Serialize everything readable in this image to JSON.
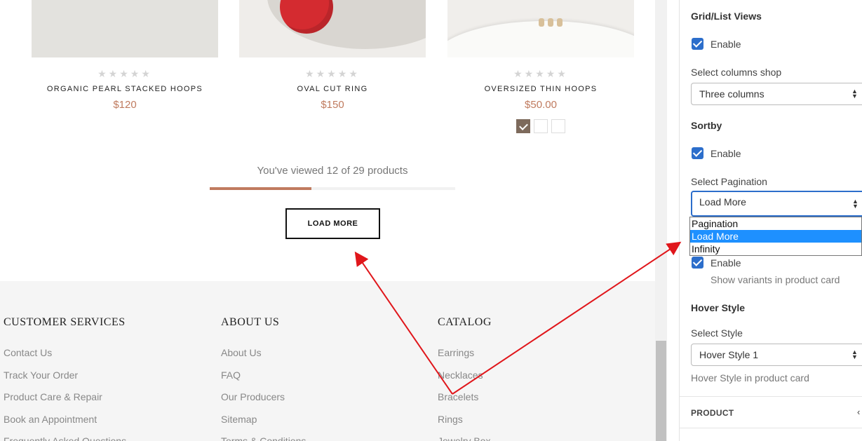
{
  "products": [
    {
      "title": "ORGANIC PEARL STACKED HOOPS",
      "price": "$120",
      "stars": "★★★★★"
    },
    {
      "title": "OVAL CUT RING",
      "price": "$150",
      "stars": "★★★★★"
    },
    {
      "title": "OVERSIZED THIN HOOPS",
      "price": "$50.00",
      "stars": "★★★★★",
      "swatch_count": 3,
      "swatch_selected": 1
    }
  ],
  "pagination": {
    "viewed_text": "You've viewed 12 of 29 products",
    "viewed": 12,
    "total": 29,
    "load_more_label": "LOAD MORE"
  },
  "footer": {
    "columns": [
      {
        "heading": "CUSTOMER SERVICES",
        "links": [
          "Contact Us",
          "Track Your Order",
          "Product Care & Repair",
          "Book an Appointment",
          "Frequently Asked Questions"
        ]
      },
      {
        "heading": "ABOUT US",
        "links": [
          "About Us",
          "FAQ",
          "Our Producers",
          "Sitemap",
          "Terms & Conditions"
        ]
      },
      {
        "heading": "CATALOG",
        "links": [
          "Earrings",
          "Necklaces",
          "Bracelets",
          "Rings",
          "Jewelry Box"
        ]
      }
    ]
  },
  "panel": {
    "grid_list": {
      "title": "Grid/List Views",
      "enable_label": "Enable",
      "enabled": true
    },
    "columns": {
      "label": "Select columns shop",
      "value": "Three columns"
    },
    "sortby": {
      "title": "Sortby",
      "enable_label": "Enable",
      "enabled": true
    },
    "pagination": {
      "label": "Select Pagination",
      "value": "Load More",
      "options": [
        "Pagination",
        "Load More",
        "Infinity"
      ],
      "selected_index": 1
    },
    "variants": {
      "enable_label": "Enable",
      "enabled": true,
      "help": "Show variants in product card"
    },
    "hover": {
      "title": "Hover Style",
      "label": "Select Style",
      "value": "Hover Style 1",
      "help": "Hover Style in product card"
    },
    "product_section": {
      "label": "PRODUCT"
    }
  },
  "colors": {
    "accent": "#c07b5f",
    "checkbox": "#2c6ecb",
    "option_highlight": "#1e90ff",
    "arrow": "#e0161b"
  },
  "icons": {
    "select_caret": "updown-caret-icon",
    "checkmark": "checkmark-icon",
    "section_arrow": "chevron-left-icon"
  }
}
